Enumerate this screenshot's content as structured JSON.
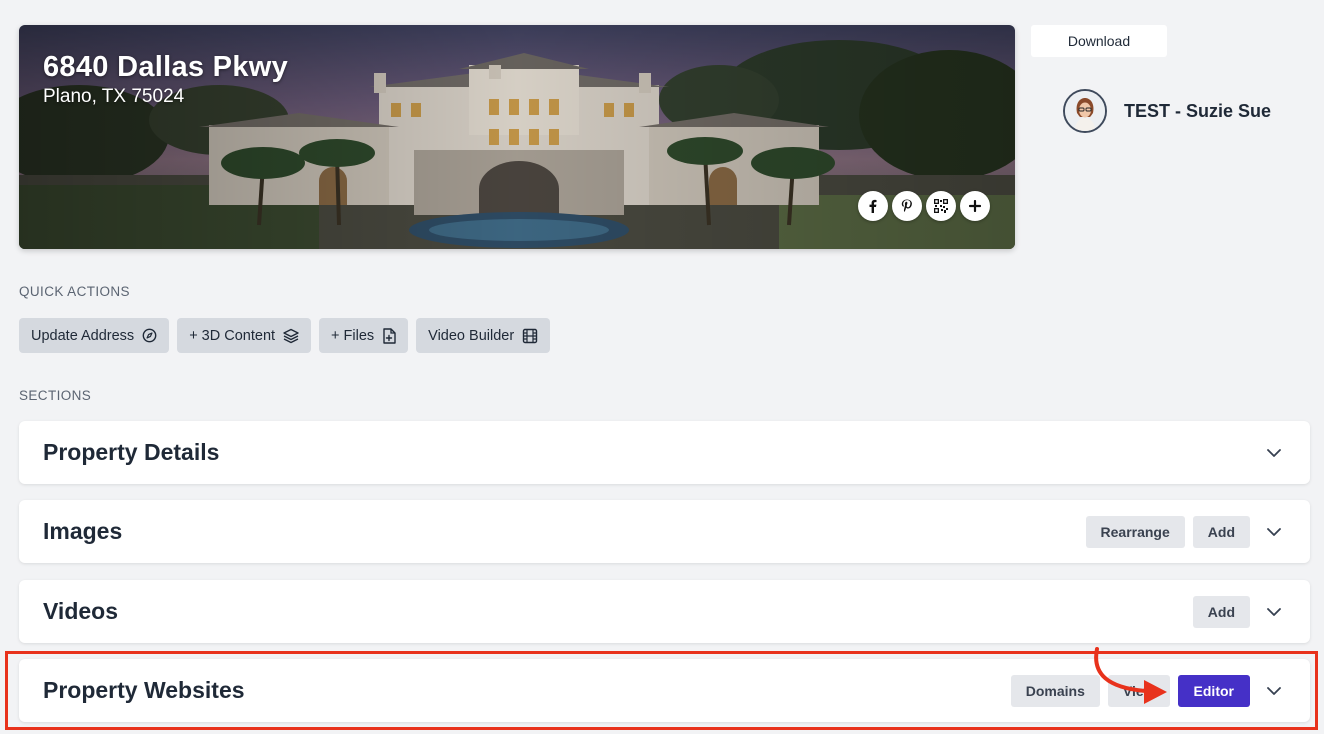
{
  "hero": {
    "address_line1": "6840 Dallas Pkwy",
    "address_line2": "Plano, TX 75024",
    "share_icons": [
      "facebook-icon",
      "pinterest-icon",
      "qr-code-icon",
      "plus-icon"
    ]
  },
  "header": {
    "download_label": "Download",
    "agent_name": "TEST - Suzie Sue"
  },
  "quick_actions": {
    "label": "QUICK ACTIONS",
    "items": [
      {
        "label": "Update Address",
        "icon": "compass-icon"
      },
      {
        "label": "+ 3D Content",
        "icon": "layers-icon"
      },
      {
        "label": "+ Files",
        "icon": "file-plus-icon"
      },
      {
        "label": "Video Builder",
        "icon": "film-icon"
      }
    ]
  },
  "sections": {
    "label": "SECTIONS",
    "items": [
      {
        "title": "Property Details",
        "actions": []
      },
      {
        "title": "Images",
        "actions": [
          "Rearrange",
          "Add"
        ]
      },
      {
        "title": "Videos",
        "actions": [
          "Add"
        ]
      },
      {
        "title": "Property Websites",
        "actions": [
          "Domains",
          "View",
          "Editor"
        ]
      }
    ]
  },
  "colors": {
    "primary": "#4530c7",
    "highlight": "#e8321c",
    "background": "#f2f3f5"
  }
}
